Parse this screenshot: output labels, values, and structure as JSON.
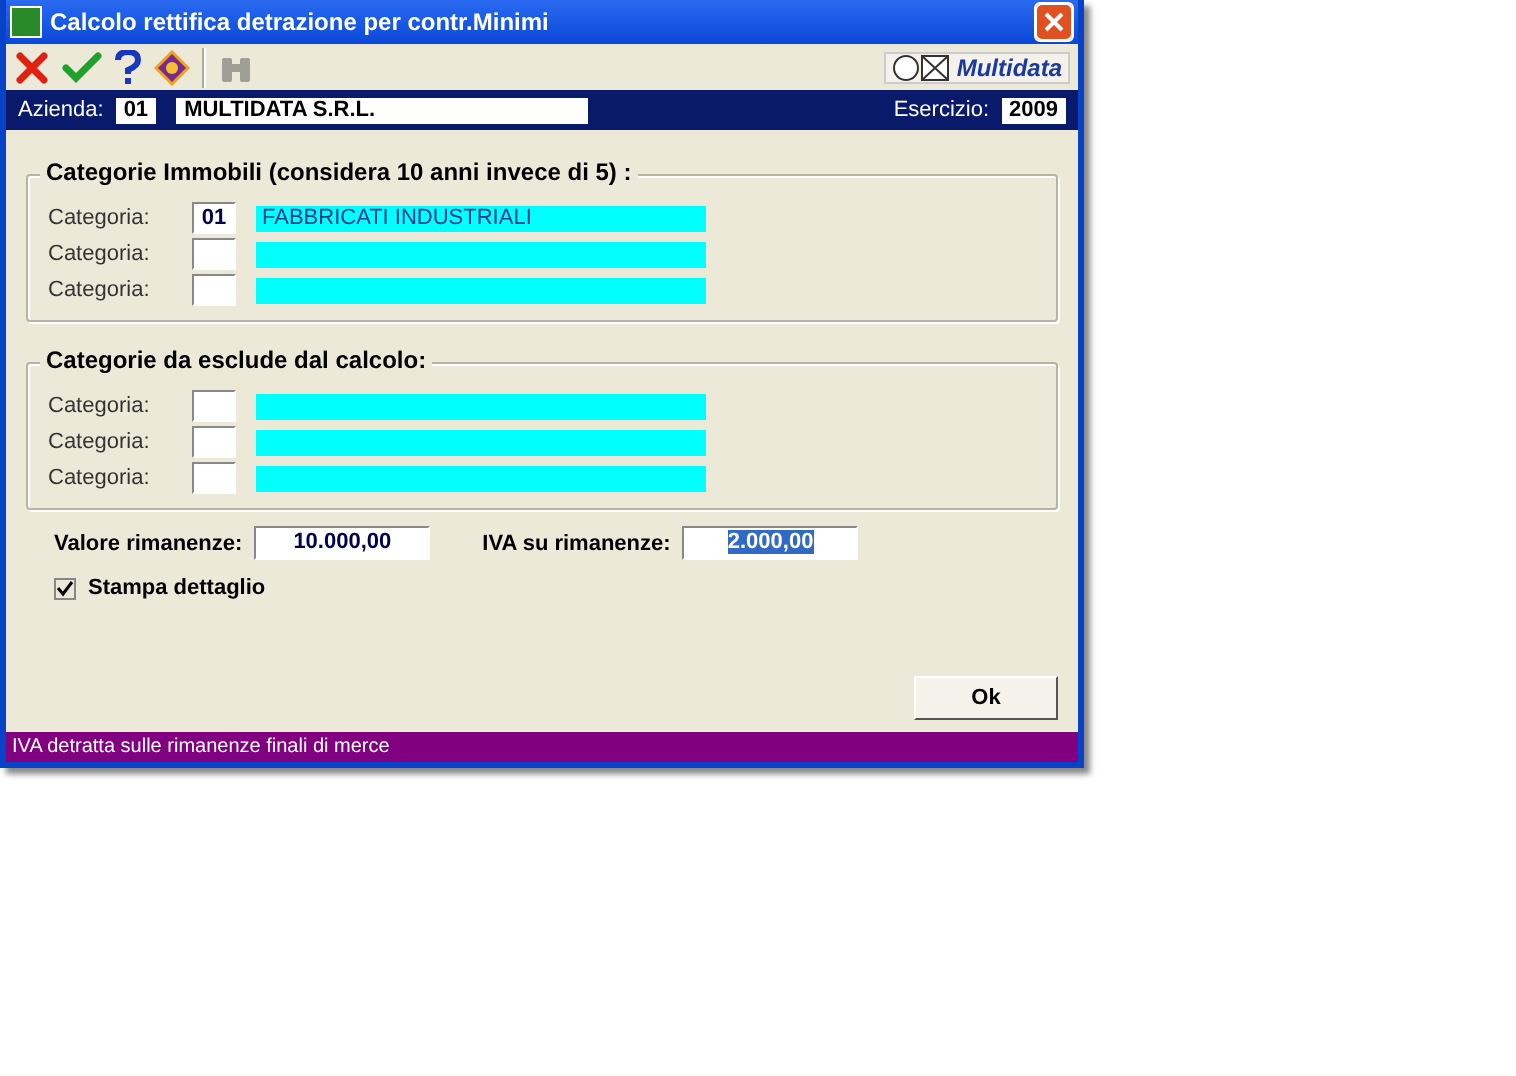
{
  "window": {
    "title": "Calcolo rettifica detrazione per contr.Minimi"
  },
  "toolbar": {
    "tools": [
      {
        "kind": "cancel",
        "disabled": false
      },
      {
        "kind": "confirm",
        "disabled": false
      },
      {
        "kind": "help",
        "disabled": false
      },
      {
        "kind": "manual",
        "disabled": false
      },
      {
        "kind": "find",
        "disabled": true
      }
    ],
    "brand": "Multidata"
  },
  "header": {
    "company_label": "Azienda:",
    "company_code": "01",
    "company_name": "MULTIDATA S.R.L.",
    "year_label": "Esercizio:",
    "year": "2009"
  },
  "groups": [
    {
      "title": "Categorie Immobili (considera 10 anni invece di 5) :",
      "rows": [
        {
          "label": "Categoria:",
          "code": "01",
          "description": "FABBRICATI INDUSTRIALI"
        },
        {
          "label": "Categoria:"
        },
        {
          "label": "Categoria:"
        }
      ]
    },
    {
      "title": "Categorie da esclude dal calcolo:",
      "rows": [
        {
          "label": "Categoria:"
        },
        {
          "label": "Categoria:"
        },
        {
          "label": "Categoria:"
        }
      ]
    }
  ],
  "values": [
    {
      "label": "Valore rimanenze:",
      "value": "10.000,00",
      "selected": false
    },
    {
      "label": "IVA su rimanenze:",
      "value": "2.000,00",
      "selected": true
    }
  ],
  "print_detail": {
    "label": "Stampa dettaglio",
    "checked": true
  },
  "ok_button": "Ok",
  "status_bar": "IVA detratta sulle rimanenze finali di merce"
}
